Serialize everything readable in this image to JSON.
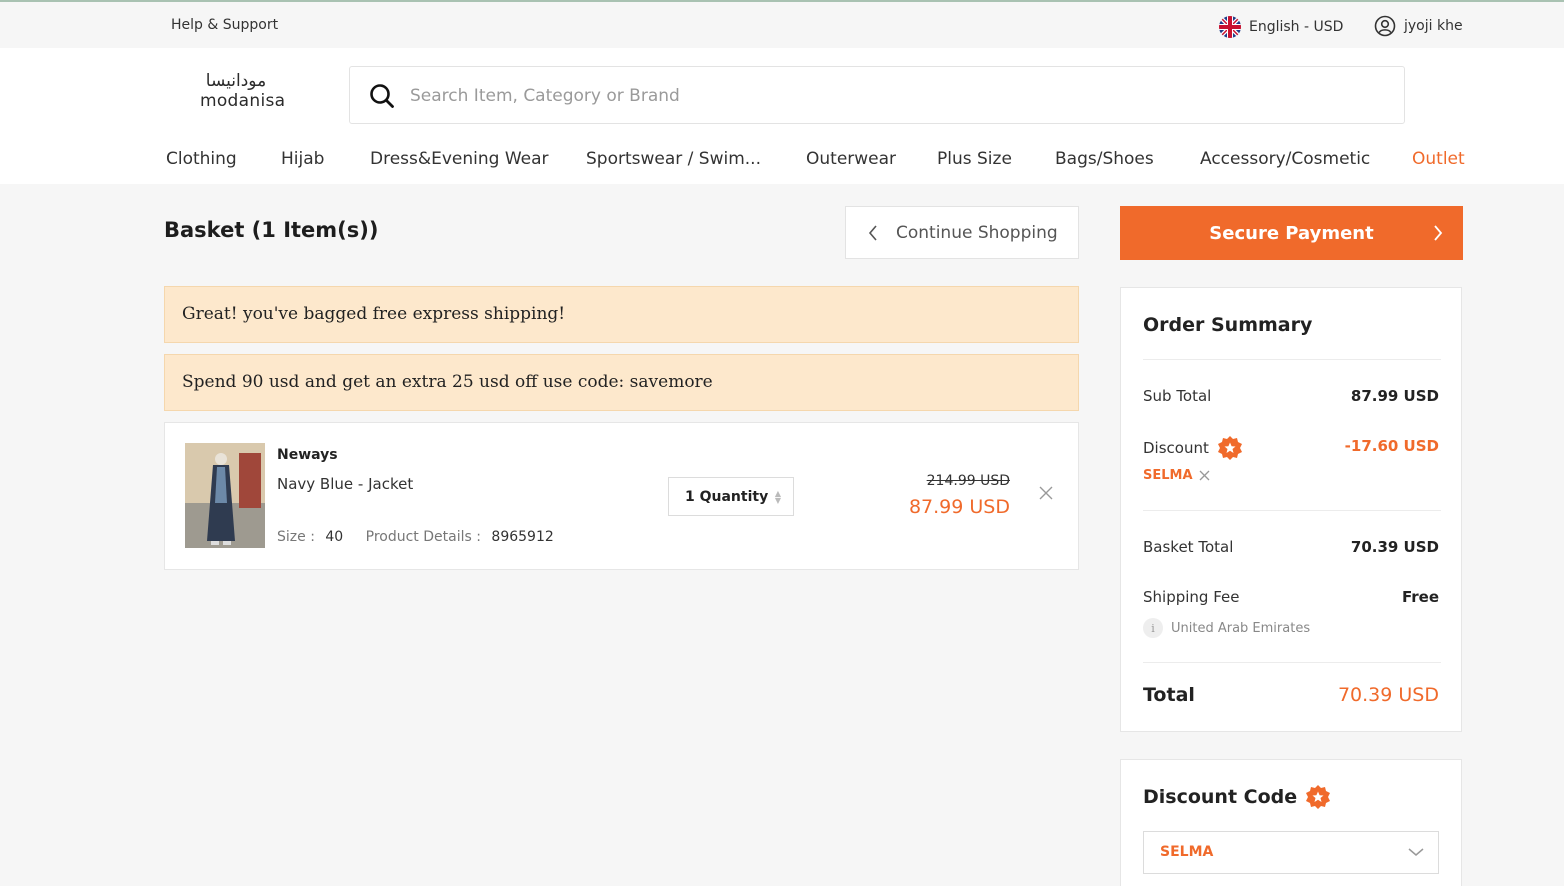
{
  "topbar": {
    "help": "Help & Support",
    "language": "English - USD",
    "user": "jyoji khe"
  },
  "header": {
    "logo_ar": "مودانيسا",
    "logo_en": "modanisa",
    "search_placeholder": "Search Item, Category or Brand",
    "nav": [
      "Clothing",
      "Hijab",
      "Dress&Evening Wear",
      "Sportswear / Swim...",
      "Outerwear",
      "Plus Size",
      "Bags/Shoes",
      "Accessory/Cosmetic",
      "Outlet"
    ]
  },
  "basket": {
    "title": "Basket (1 Item(s))",
    "continue_label": "Continue Shopping",
    "banners": [
      "Great! you've bagged free express shipping!",
      "Spend 90 usd and get an extra 25 usd off use code: savemore"
    ],
    "item": {
      "brand": "Neways",
      "name": "Navy Blue - Jacket",
      "size_label": "Size :",
      "size": "40",
      "details_label": "Product Details :",
      "details": "8965912",
      "quantity": "1 Quantity",
      "old_price": "214.99 USD",
      "price": "87.99 USD"
    }
  },
  "summary": {
    "pay_label": "Secure Payment",
    "title": "Order Summary",
    "subtotal_label": "Sub Total",
    "subtotal": "87.99 USD",
    "discount_label": "Discount",
    "discount": "-17.60 USD",
    "discount_code": "SELMA",
    "basket_total_label": "Basket Total",
    "basket_total": "70.39 USD",
    "shipping_label": "Shipping Fee",
    "shipping": "Free",
    "shipping_country": "United Arab Emirates",
    "info_glyph": "i",
    "total_label": "Total",
    "total": "70.39 USD"
  },
  "discount_code": {
    "title": "Discount Code",
    "selected": "SELMA"
  },
  "colors": {
    "accent": "#f06a2b",
    "banner": "#fde8cc"
  }
}
